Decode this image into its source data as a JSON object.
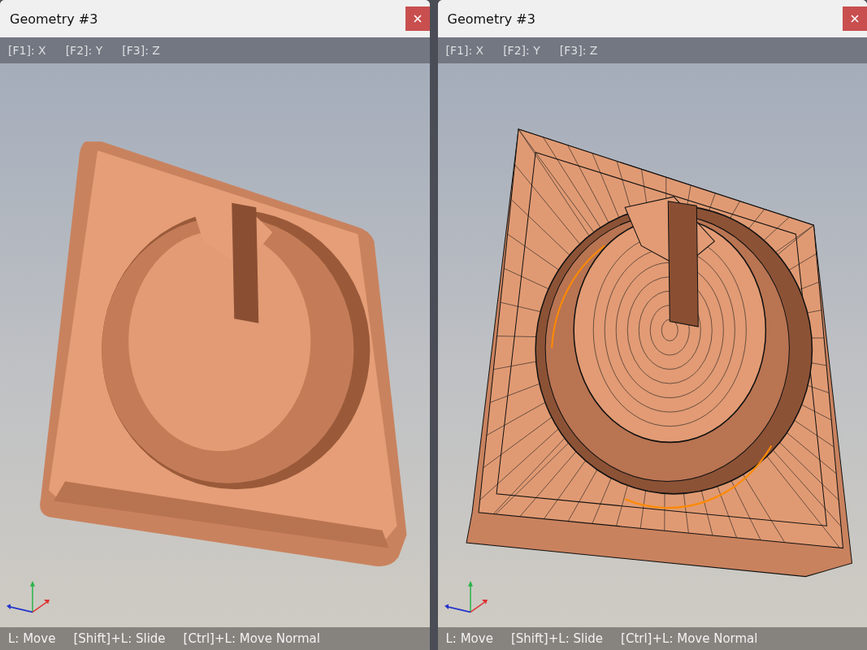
{
  "windows": [
    {
      "title": "Geometry #3",
      "kind": "shaded",
      "hints": [
        "[F1]: X",
        "[F2]: Y",
        "[F3]: Z"
      ],
      "footer": [
        "L: Move",
        "[Shift]+L: Slide",
        "[Ctrl]+L: Move Normal"
      ]
    },
    {
      "title": "Geometry #3",
      "kind": "wireframe",
      "hints": [
        "[F1]: X",
        "[F2]: Y",
        "[F3]: Z"
      ],
      "footer": [
        "L: Move",
        "[Shift]+L: Slide",
        "[Ctrl]+L: Move Normal"
      ]
    }
  ]
}
